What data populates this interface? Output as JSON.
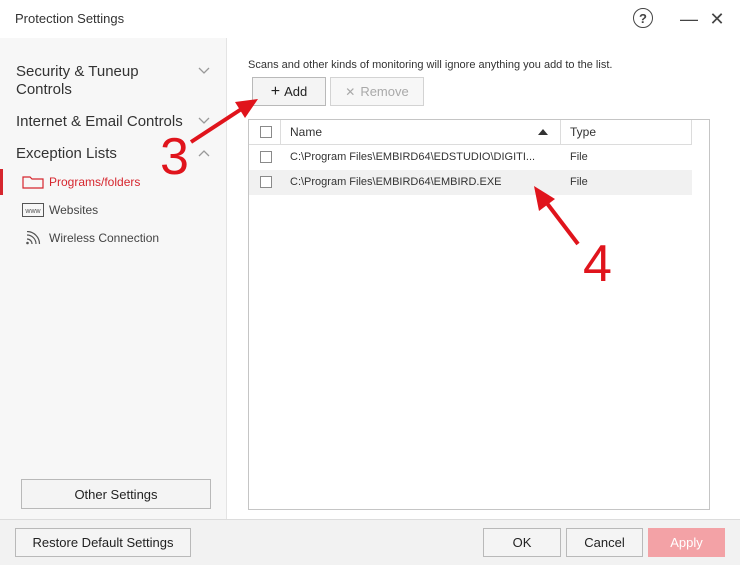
{
  "window": {
    "title": "Protection Settings",
    "help_glyph": "?",
    "minimize_glyph": "—",
    "close_glyph": "✕"
  },
  "sidebar": {
    "categories": [
      {
        "label": "Security & Tuneup Controls",
        "expanded": false
      },
      {
        "label": "Internet & Email Controls",
        "expanded": false
      },
      {
        "label": "Exception Lists",
        "expanded": true
      }
    ],
    "items": [
      {
        "label": "Programs/folders",
        "icon": "folder-icon",
        "active": true
      },
      {
        "label": "Websites",
        "icon": "www-icon",
        "active": false
      },
      {
        "label": "Wireless Connection",
        "icon": "wifi-icon",
        "active": false
      }
    ],
    "other_settings_label": "Other Settings"
  },
  "main": {
    "description": "Scans and other kinds of monitoring will ignore anything you add to the list.",
    "add_label": "Add",
    "remove_label": "Remove",
    "columns": {
      "name": "Name",
      "type": "Type"
    },
    "rows": [
      {
        "name": "C:\\Program Files\\EMBIRD64\\EDSTUDIO\\DIGITI...",
        "type": "File"
      },
      {
        "name": "C:\\Program Files\\EMBIRD64\\EMBIRD.EXE",
        "type": "File"
      }
    ]
  },
  "footer": {
    "restore_label": "Restore Default Settings",
    "ok_label": "OK",
    "cancel_label": "Cancel",
    "apply_label": "Apply"
  },
  "annotations": {
    "step3": "3",
    "step4": "4"
  },
  "colors": {
    "accent": "#d6262e",
    "annotation": "#e0141c",
    "apply_disabled": "#f3a2a6"
  }
}
